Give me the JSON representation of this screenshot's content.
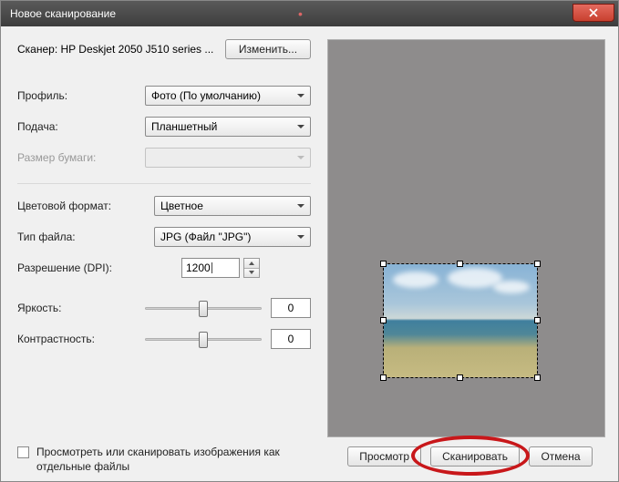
{
  "window": {
    "title": "Новое сканирование"
  },
  "scanner": {
    "label": "Сканер:",
    "name": "HP Deskjet 2050 J510 series ...",
    "change_btn": "Изменить..."
  },
  "profile": {
    "label": "Профиль:",
    "value": "Фото (По умолчанию)"
  },
  "source": {
    "label": "Подача:",
    "value": "Планшетный"
  },
  "paper": {
    "label": "Размер бумаги:",
    "value": ""
  },
  "color": {
    "label": "Цветовой формат:",
    "value": "Цветное"
  },
  "filetype": {
    "label": "Тип файла:",
    "value": "JPG (Файл \"JPG\")"
  },
  "dpi": {
    "label": "Разрешение (DPI):",
    "value": "1200"
  },
  "brightness": {
    "label": "Яркость:",
    "value": "0"
  },
  "contrast": {
    "label": "Контрастность:",
    "value": "0"
  },
  "separate_files": {
    "label": "Просмотреть или сканировать изображения как отдельные файлы"
  },
  "buttons": {
    "preview": "Просмотр",
    "scan": "Сканировать",
    "cancel": "Отмена"
  }
}
